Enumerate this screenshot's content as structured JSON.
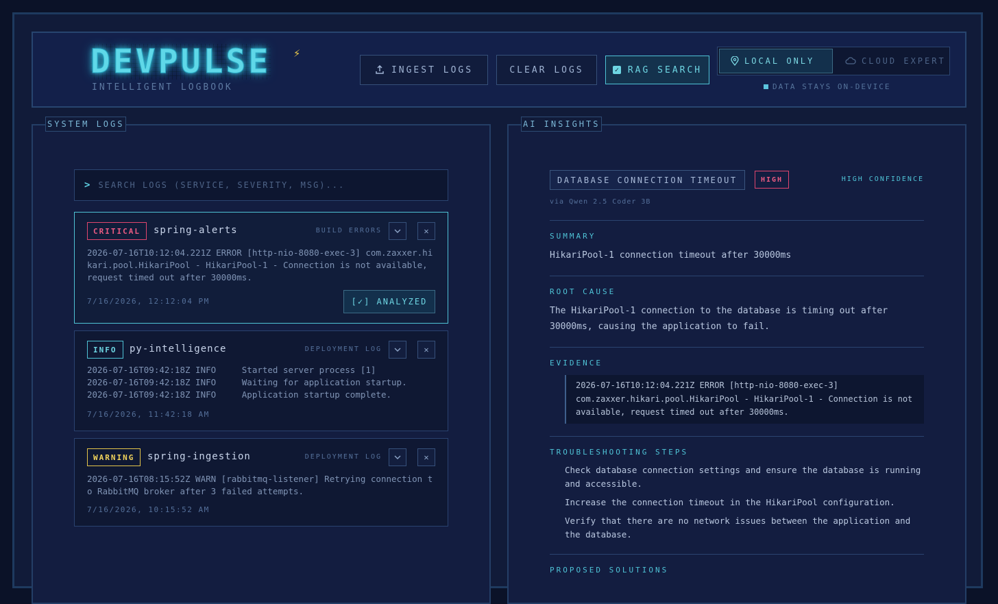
{
  "header": {
    "logo": "DEVPULSE",
    "subtitle": "INTELLIGENT LOGBOOK",
    "buttons": {
      "ingest": "INGEST LOGS",
      "clear": "CLEAR LOGS",
      "rag": "RAG SEARCH"
    },
    "mode_toggle": {
      "local": "LOCAL ONLY",
      "cloud": "CLOUD EXPERT",
      "selected": "LOCAL ONLY"
    },
    "privacy_note": "DATA STAYS ON-DEVICE"
  },
  "logs_panel": {
    "title": "SYSTEM LOGS",
    "search_placeholder": "SEARCH LOGS (SERVICE, SEVERITY, MSG)...",
    "entries": [
      {
        "severity": "CRITICAL",
        "service": "spring-alerts",
        "category": "BUILD ERRORS",
        "message": "2026-07-16T10:12:04.221Z ERROR [http-nio-8080-exec-3] com.zaxxer.hikari.pool.HikariPool - HikariPool-1 - Connection is not available, request timed out after 30000ms.",
        "timestamp": "7/16/2026, 12:12:04 PM",
        "analyzed_label": "[✓] ANALYZED"
      },
      {
        "severity": "INFO",
        "service": "py-intelligence",
        "category": "DEPLOYMENT LOG",
        "message": "2026-07-16T09:42:18Z INFO     Started server process [1]\n2026-07-16T09:42:18Z INFO     Waiting for application startup.\n2026-07-16T09:42:18Z INFO     Application startup complete.",
        "timestamp": "7/16/2026, 11:42:18 AM"
      },
      {
        "severity": "WARNING",
        "service": "spring-ingestion",
        "category": "DEPLOYMENT LOG",
        "message": "2026-07-16T08:15:52Z WARN [rabbitmq-listener] Retrying connection to RabbitMQ broker after 3 failed attempts.",
        "timestamp": "7/16/2026, 10:15:52 AM"
      }
    ]
  },
  "insights_panel": {
    "title": "AI INSIGHTS",
    "issue_title": "DATABASE CONNECTION TIMEOUT",
    "severity": "HIGH",
    "confidence": "HIGH CONFIDENCE",
    "model": "via Qwen 2.5 Coder 3B",
    "summary_heading": "SUMMARY",
    "summary": "HikariPool-1 connection timeout after 30000ms",
    "root_cause_heading": "ROOT CAUSE",
    "root_cause": "The HikariPool-1 connection to the database is timing out after 30000ms, causing the application to fail.",
    "evidence_heading": "EVIDENCE",
    "evidence": "2026-07-16T10:12:04.221Z ERROR [http-nio-8080-exec-3] com.zaxxer.hikari.pool.HikariPool - HikariPool-1 - Connection is not available, request timed out after 30000ms.",
    "steps_heading": "TROUBLESHOOTING STEPS",
    "steps": [
      "Check database connection settings and ensure the database is running and accessible.",
      "Increase the connection timeout in the HikariPool configuration.",
      "Verify that there are no network issues between the application and the database."
    ],
    "solutions_heading": "PROPOSED SOLUTIONS"
  },
  "colors": {
    "accent": "#4fc3d6",
    "critical": "#e0466e",
    "warning": "#e5c54a",
    "background": "#0b1228"
  }
}
